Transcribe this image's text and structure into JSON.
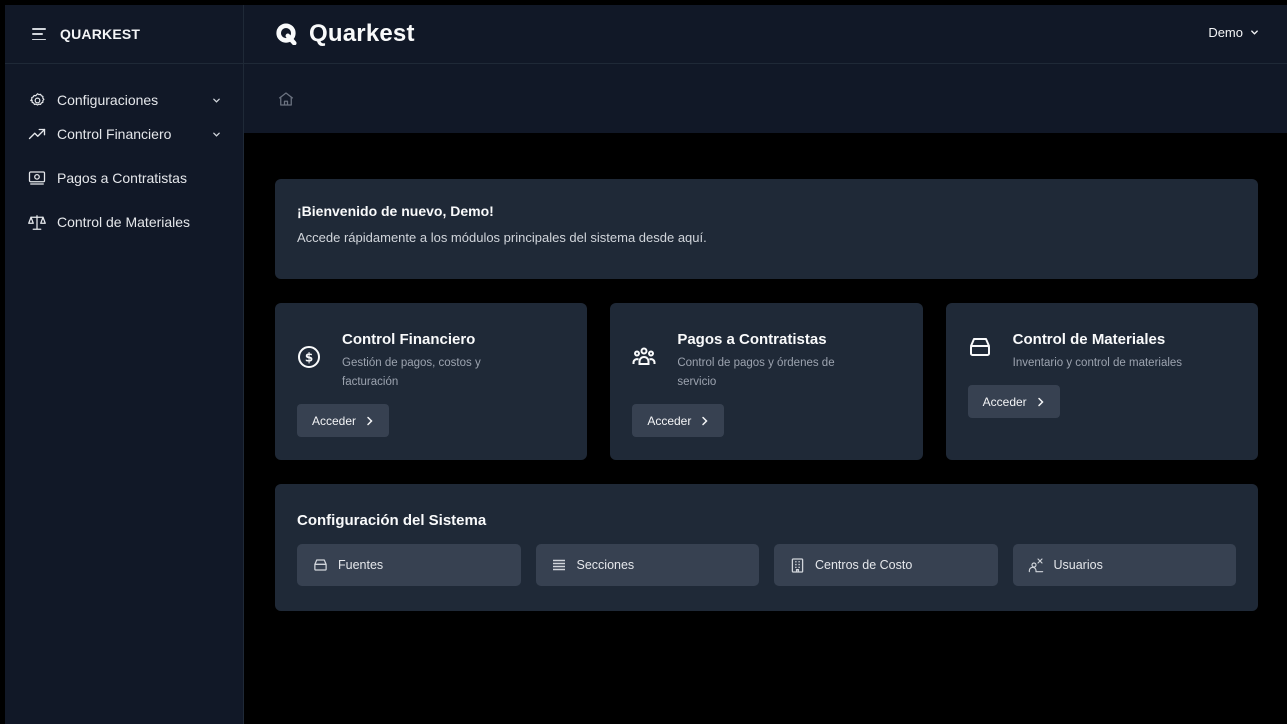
{
  "sidebar": {
    "brand": "QUARKEST",
    "items": [
      {
        "label": "Configuraciones",
        "icon": "gear-icon",
        "expandable": true
      },
      {
        "label": "Control Financiero",
        "icon": "trending-up-icon",
        "expandable": true
      },
      {
        "label": "Pagos a Contratistas",
        "icon": "banknote-icon",
        "expandable": false
      },
      {
        "label": "Control de Materiales",
        "icon": "scale-icon",
        "expandable": false
      }
    ]
  },
  "header": {
    "logo_text": "Quarkest",
    "user_menu": "Demo"
  },
  "breadcrumb": {
    "icon": "home-icon"
  },
  "welcome": {
    "title": "¡Bienvenido de nuevo, Demo!",
    "subtitle": "Accede rápidamente a los módulos principales del sistema desde aquí."
  },
  "modules": [
    {
      "title": "Control Financiero",
      "description": "Gestión de pagos, costos y facturación",
      "button": "Acceder",
      "icon": "dollar-circle-icon"
    },
    {
      "title": "Pagos a Contratistas",
      "description": "Control de pagos y órdenes de servicio",
      "button": "Acceder",
      "icon": "users-group-icon"
    },
    {
      "title": "Control de Materiales",
      "description": "Inventario y control de materiales",
      "button": "Acceder",
      "icon": "archive-icon"
    }
  ],
  "config": {
    "title": "Configuración del Sistema",
    "items": [
      {
        "label": "Fuentes",
        "icon": "archive-icon"
      },
      {
        "label": "Secciones",
        "icon": "list-icon"
      },
      {
        "label": "Centros de Costo",
        "icon": "building-icon"
      },
      {
        "label": "Usuarios",
        "icon": "user-cog-icon"
      }
    ]
  },
  "colors": {
    "sidebar_bg": "#111827",
    "card_bg": "#1f2937",
    "button_bg": "#374151",
    "page_bg": "#000000"
  }
}
